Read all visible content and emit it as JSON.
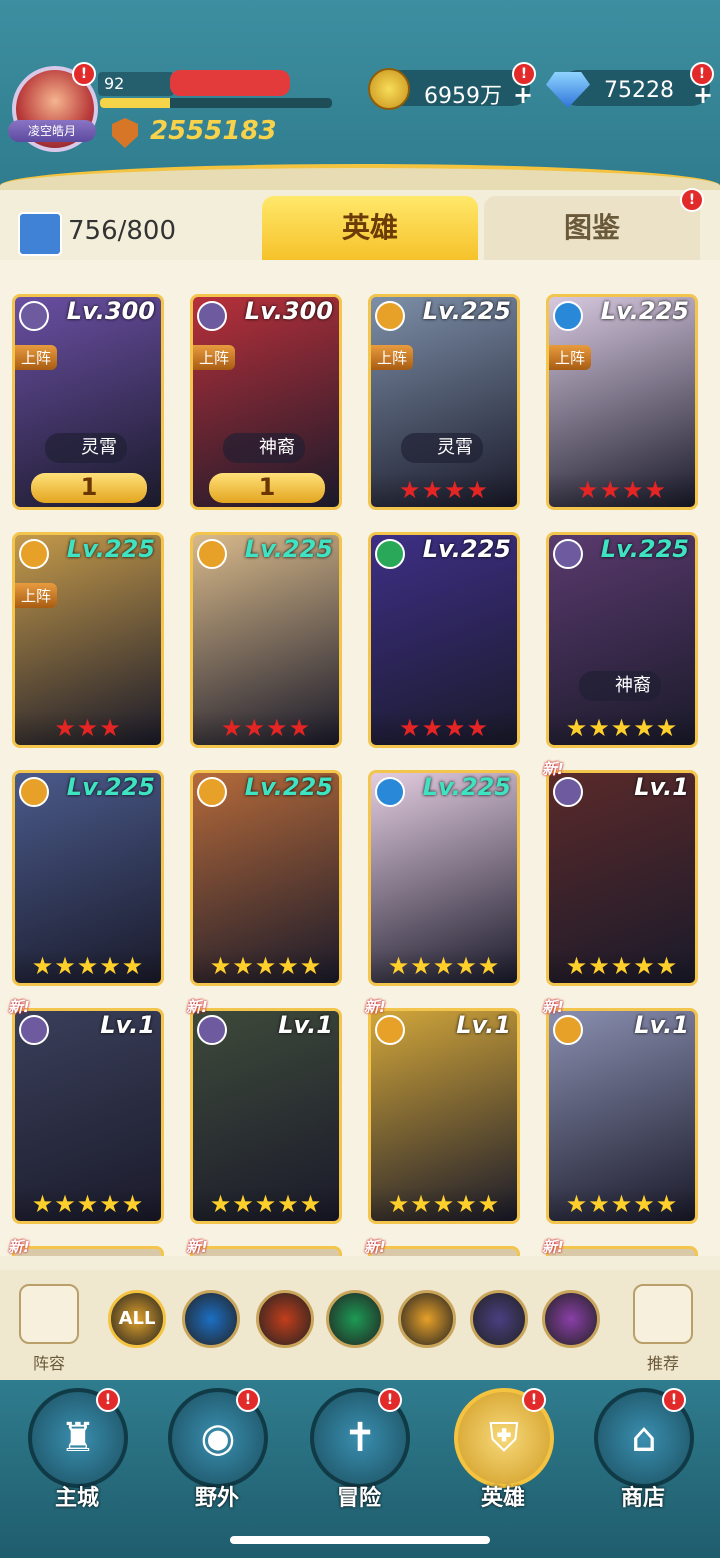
{
  "header": {
    "avatar_badge": "凌空皓月",
    "player_level": "92",
    "exp_fraction": 0.3,
    "power": "2555183",
    "gold": "6959万",
    "gems": "75228",
    "alert": "!",
    "plus": "+"
  },
  "collection": {
    "count": "756/800"
  },
  "tabs": [
    {
      "label": "英雄"
    },
    {
      "label": "图鉴"
    }
  ],
  "cards": [
    {
      "level": "Lv.300",
      "tag": "上阵",
      "role": "灵霄",
      "rank": "1",
      "stars": "",
      "star_color": "gold",
      "bg": "#6a4fa3",
      "faction_color": "#6e5a9e",
      "level_color": "white",
      "new": ""
    },
    {
      "level": "Lv.300",
      "tag": "上阵",
      "role": "神裔",
      "rank": "1",
      "stars": "",
      "star_color": "gold",
      "bg": "#b8303a",
      "faction_color": "#6e5a9e",
      "level_color": "white",
      "new": ""
    },
    {
      "level": "Lv.225",
      "tag": "上阵",
      "role": "灵霄",
      "rank": "",
      "stars": "★★★★",
      "star_color": "red",
      "bg": "#7d8fa8",
      "faction_color": "#e7a129",
      "level_color": "white",
      "new": ""
    },
    {
      "level": "Lv.225",
      "tag": "上阵",
      "role": "",
      "rank": "",
      "stars": "★★★★",
      "star_color": "red",
      "bg": "#d7c8df",
      "faction_color": "#2a88d8",
      "level_color": "white",
      "new": ""
    },
    {
      "level": "Lv.225",
      "tag": "上阵",
      "role": "",
      "rank": "",
      "stars": "★★★",
      "star_color": "red",
      "bg": "#c49a4a",
      "faction_color": "#e7a129",
      "level_color": "green",
      "new": ""
    },
    {
      "level": "Lv.225",
      "tag": "",
      "role": "",
      "rank": "",
      "stars": "★★★★",
      "star_color": "red",
      "bg": "#d8b98a",
      "faction_color": "#e7a129",
      "level_color": "green",
      "new": ""
    },
    {
      "level": "Lv.225",
      "tag": "",
      "role": "",
      "rank": "",
      "stars": "★★★★",
      "star_color": "red",
      "bg": "#3e2f86",
      "faction_color": "#2aa85a",
      "level_color": "white",
      "new": ""
    },
    {
      "level": "Lv.225",
      "tag": "",
      "role": "神裔",
      "rank": "",
      "stars": "★★★★★",
      "star_color": "gold",
      "bg": "#5a3a6e",
      "faction_color": "#6e5a9e",
      "level_color": "green",
      "new": ""
    },
    {
      "level": "Lv.225",
      "tag": "",
      "role": "",
      "rank": "",
      "stars": "★★★★★",
      "star_color": "gold",
      "bg": "#4a5a8a",
      "faction_color": "#e7a129",
      "level_color": "green",
      "new": ""
    },
    {
      "level": "Lv.225",
      "tag": "",
      "role": "",
      "rank": "",
      "stars": "★★★★★",
      "star_color": "gold",
      "bg": "#b56a3a",
      "faction_color": "#e7a129",
      "level_color": "green",
      "new": ""
    },
    {
      "level": "Lv.225",
      "tag": "",
      "role": "",
      "rank": "",
      "stars": "★★★★★",
      "star_color": "gold",
      "bg": "#e3cce0",
      "faction_color": "#2a88d8",
      "level_color": "green",
      "new": ""
    },
    {
      "level": "Lv.1",
      "tag": "",
      "role": "",
      "rank": "",
      "stars": "★★★★★",
      "star_color": "gold",
      "bg": "#5a2a2a",
      "faction_color": "#6e5a9e",
      "level_color": "white",
      "new": "新!"
    },
    {
      "level": "Lv.1",
      "tag": "",
      "role": "",
      "rank": "",
      "stars": "★★★★★",
      "star_color": "gold",
      "bg": "#3a3f5a",
      "faction_color": "#6e5a9e",
      "level_color": "white",
      "new": "新!"
    },
    {
      "level": "Lv.1",
      "tag": "",
      "role": "",
      "rank": "",
      "stars": "★★★★★",
      "star_color": "gold",
      "bg": "#3e4a3a",
      "faction_color": "#6e5a9e",
      "level_color": "white",
      "new": "新!"
    },
    {
      "level": "Lv.1",
      "tag": "",
      "role": "",
      "rank": "",
      "stars": "★★★★★",
      "star_color": "gold",
      "bg": "#d2a63a",
      "faction_color": "#e7a129",
      "level_color": "white",
      "new": "新!"
    },
    {
      "level": "Lv.1",
      "tag": "",
      "role": "",
      "rank": "",
      "stars": "★★★★★",
      "star_color": "gold",
      "bg": "#8a8fb0",
      "faction_color": "#e7a129",
      "level_color": "white",
      "new": "新!"
    }
  ],
  "partial_new": "新!",
  "filters": {
    "lineup": "阵容",
    "all": "ALL",
    "recommend": "推荐",
    "icons": [
      "all-faction-icon",
      "water-faction-icon",
      "fire-faction-icon",
      "wind-faction-icon",
      "light-faction-icon",
      "dark-faction-icon",
      "arcane-faction-icon"
    ],
    "colors": [
      "#e0a12a",
      "#1c6fc4",
      "#c23e1c",
      "#1d9a55",
      "#e7a129",
      "#4a3f82",
      "#8a3fa8"
    ]
  },
  "nav": [
    {
      "label": "主城",
      "icon": "castle-icon"
    },
    {
      "label": "野外",
      "icon": "gate-icon"
    },
    {
      "label": "冒险",
      "icon": "sword-icon"
    },
    {
      "label": "英雄",
      "icon": "helmet-icon"
    },
    {
      "label": "商店",
      "icon": "shop-icon"
    }
  ]
}
